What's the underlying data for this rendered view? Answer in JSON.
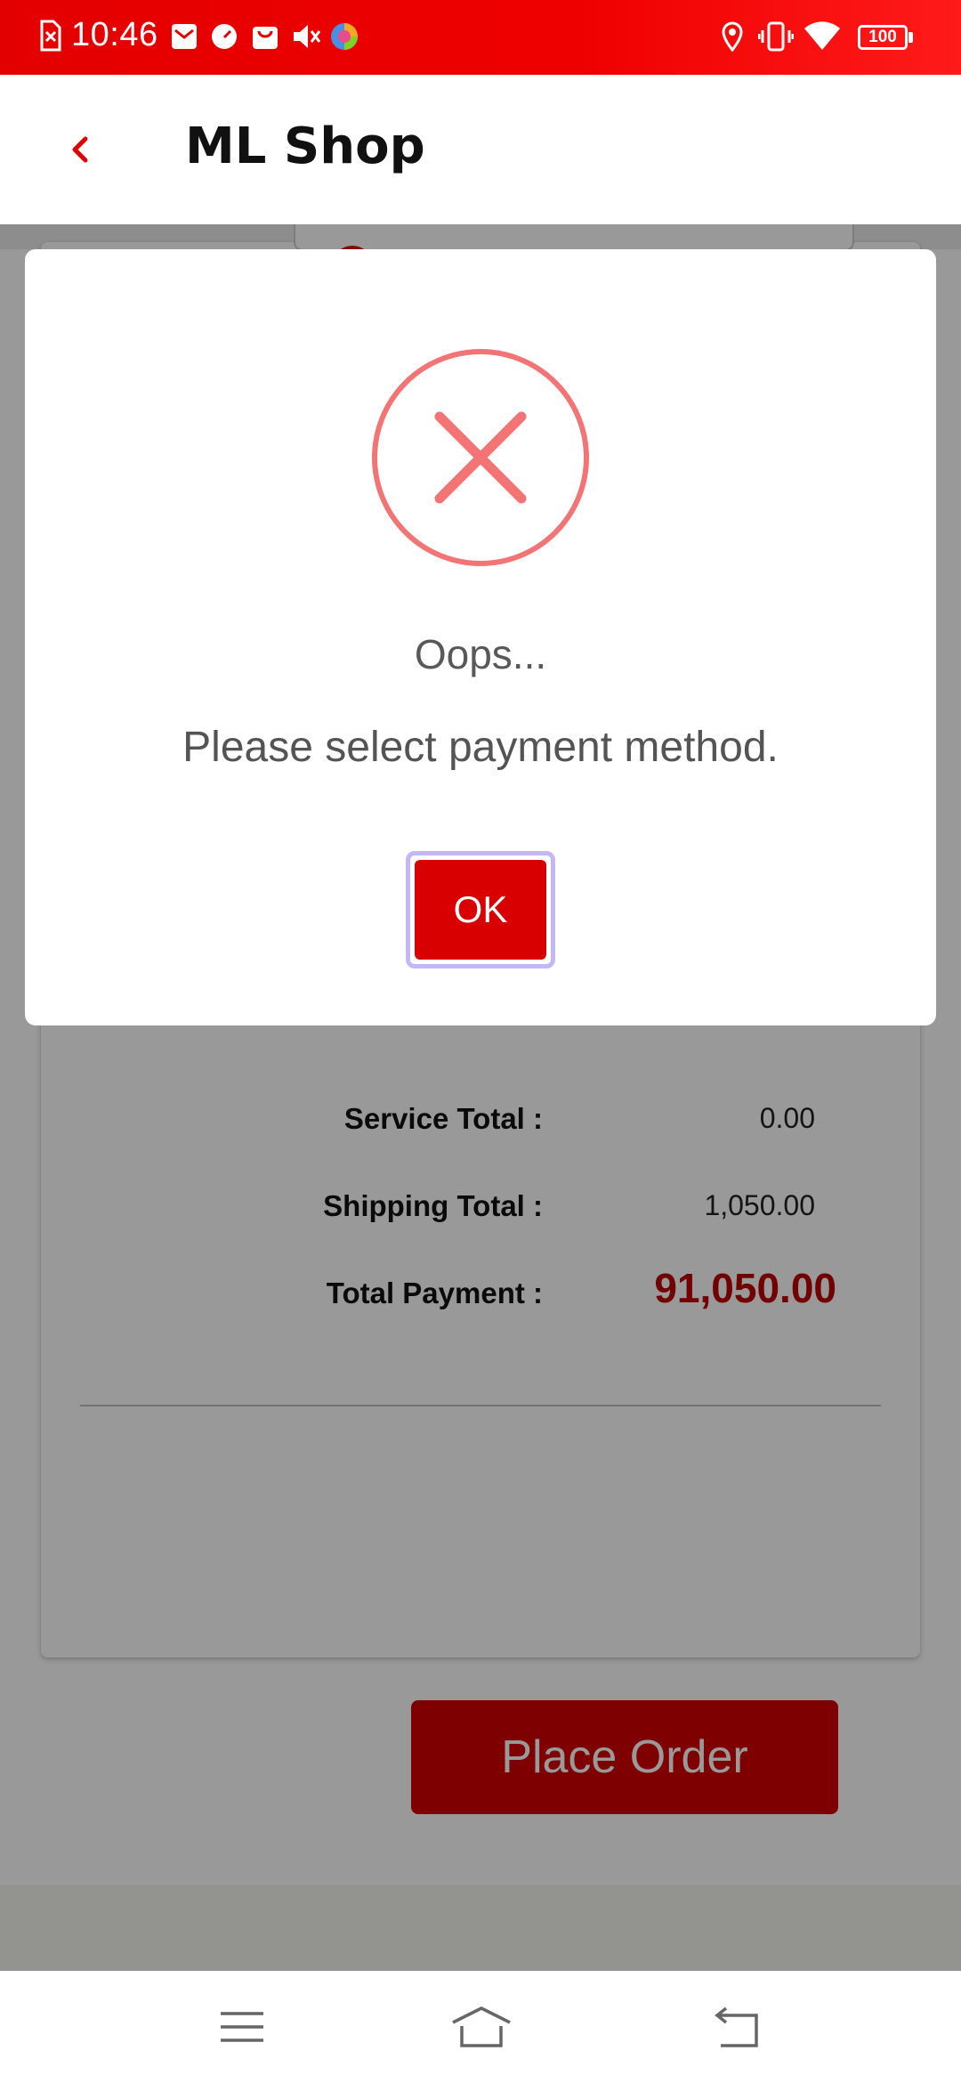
{
  "status_bar": {
    "time": "10:46",
    "battery": "100",
    "icons": [
      "sim-error-icon",
      "mail-icon",
      "speedometer-icon",
      "shopping-bag-icon",
      "muted-speaker-icon",
      "browser-icon",
      "location-icon",
      "vibrate-icon",
      "wifi-icon",
      "battery-icon"
    ],
    "color": "#e30000"
  },
  "header": {
    "title": "ML Shop",
    "back_icon": "chevron-left-icon",
    "accent": "#e00000"
  },
  "summary": {
    "service_total_label": "Service Total :",
    "service_total_value": "0.00",
    "shipping_total_label": "Shipping Total :",
    "shipping_total_value": "1,050.00",
    "total_payment_label": "Total Payment :",
    "total_payment_value": "91,050.00",
    "place_order_label": "Place Order"
  },
  "dialog": {
    "icon": "error-x-icon",
    "title": "Oops...",
    "message": "Please select payment method.",
    "ok_label": "OK",
    "icon_color": "#f27474",
    "button_color": "#d80000"
  },
  "nav_bar": {
    "icons": [
      "menu-icon",
      "home-icon",
      "back-icon"
    ]
  }
}
